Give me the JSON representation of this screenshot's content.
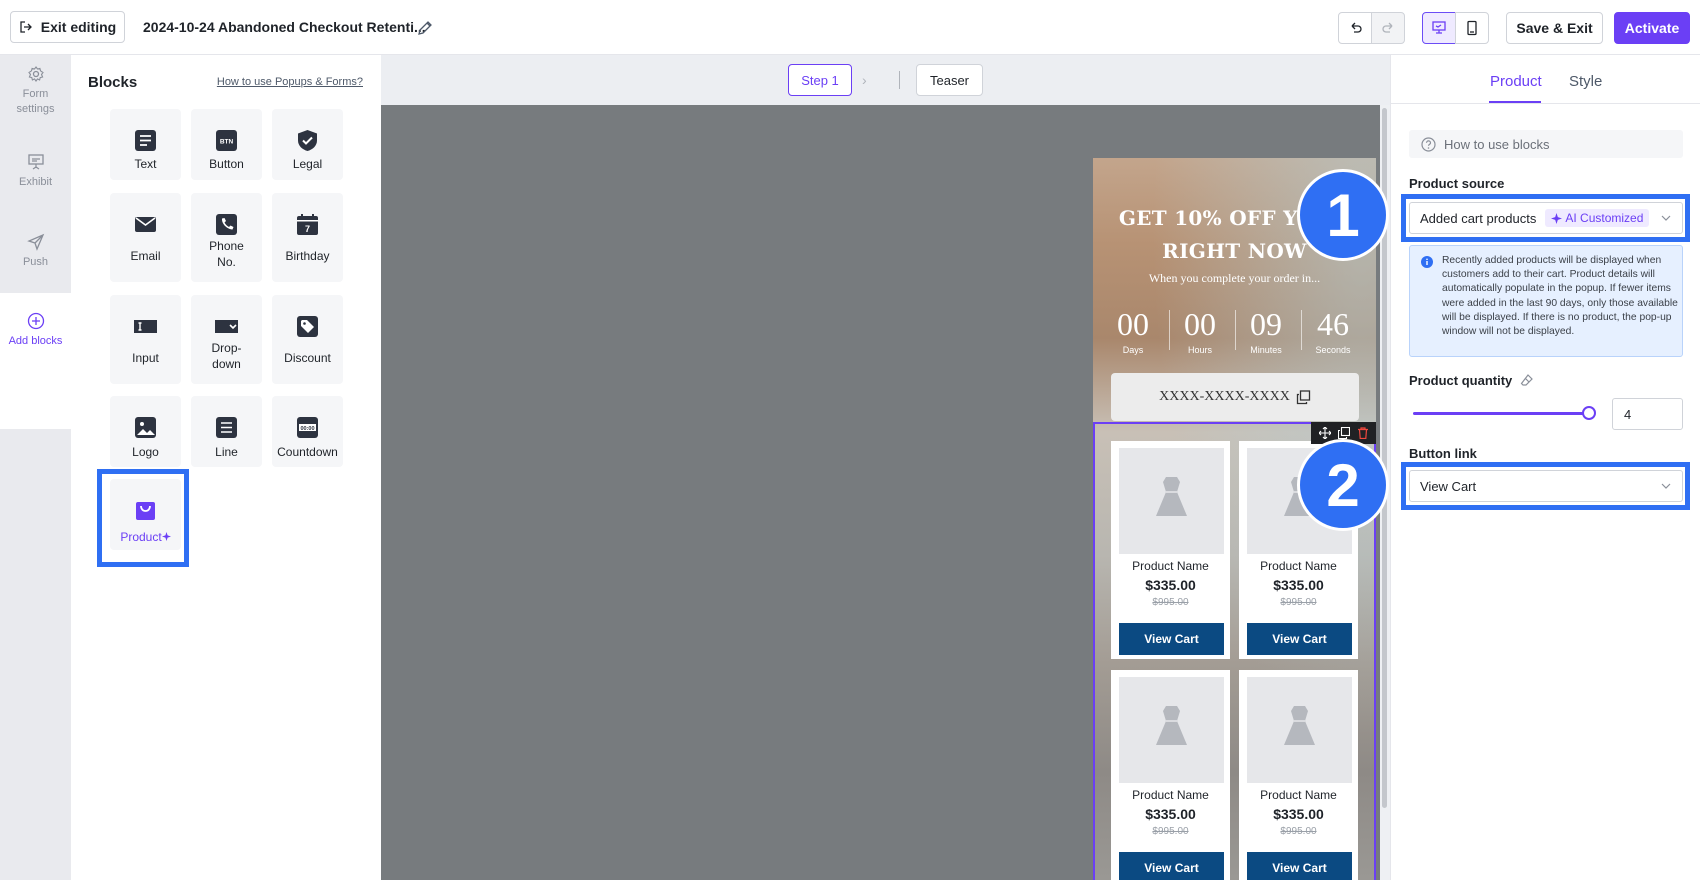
{
  "topbar": {
    "exit_label": "Exit editing",
    "doc_title": "2024-10-24 Abandoned Checkout Retenti...",
    "save_exit_label": "Save & Exit",
    "activate_label": "Activate"
  },
  "rail": {
    "items": [
      {
        "label_1": "Form",
        "label_2": "settings",
        "icon": "gear-icon"
      },
      {
        "label": "Exhibit",
        "icon": "presentation-icon"
      },
      {
        "label": "Push",
        "icon": "send-icon"
      },
      {
        "label": "Add blocks",
        "icon": "plus-circle-icon"
      }
    ]
  },
  "blocks": {
    "title": "Blocks",
    "help_link": "How to use Popups & Forms?",
    "tiles": [
      {
        "label": "Text",
        "icon": "text-icon"
      },
      {
        "label": "Button",
        "icon": "button-icon",
        "icon_text": "BTN"
      },
      {
        "label": "Legal",
        "icon": "shield-check-icon"
      },
      {
        "label": "Email",
        "icon": "envelope-icon"
      },
      {
        "label_1": "Phone",
        "label_2": "No.",
        "icon": "phone-icon"
      },
      {
        "label": "Birthday",
        "icon": "calendar-icon",
        "icon_text": "7"
      },
      {
        "label": "Input",
        "icon": "input-icon"
      },
      {
        "label_1": "Drop-",
        "label_2": "down",
        "icon": "dropdown-icon"
      },
      {
        "label": "Discount",
        "icon": "tag-icon"
      },
      {
        "label": "Logo",
        "icon": "image-icon"
      },
      {
        "label": "Line",
        "icon": "line-icon"
      },
      {
        "label": "Countdown",
        "icon": "countdown-icon",
        "icon_text": "00:00"
      },
      {
        "label": "Product",
        "icon": "shopping-bag-icon"
      }
    ]
  },
  "canvas": {
    "step_label": "Step 1",
    "teaser_label": "Teaser",
    "popup": {
      "title_line1": "GET 10% OFF YOUR",
      "title_line2": "RIGHT NOW",
      "subtitle": "When you complete your order in...",
      "countdown": [
        {
          "value": "00",
          "label": "Days"
        },
        {
          "value": "00",
          "label": "Hours"
        },
        {
          "value": "09",
          "label": "Minutes"
        },
        {
          "value": "46",
          "label": "Seconds"
        }
      ],
      "coupon_code": "XXXX-XXXX-XXXX",
      "products": [
        {
          "name": "Product Name",
          "price": "$335.00",
          "old_price": "$995.00",
          "button": "View Cart"
        },
        {
          "name": "Product Name",
          "price": "$335.00",
          "old_price": "$995.00",
          "button": "View Cart"
        },
        {
          "name": "Product Name",
          "price": "$335.00",
          "old_price": "$995.00",
          "button": "View Cart"
        },
        {
          "name": "Product Name",
          "price": "$335.00",
          "old_price": "$995.00",
          "button": "View Cart"
        }
      ]
    }
  },
  "right_panel": {
    "tabs": [
      "Product",
      "Style"
    ],
    "how_to": "How to use blocks",
    "product_source_label": "Product source",
    "product_source_value": "Added cart products",
    "ai_badge": "AI Customized",
    "info_text": "Recently added products will be displayed when customers add to their cart. Product details will automatically populate in the popup. If fewer items were added in the last 90 days, only those available will be displayed. If there is no product, the pop-up window will not be displayed.",
    "quantity_label": "Product quantity",
    "quantity_value": "4",
    "quantity_slider_level": 1.0,
    "button_link_label": "Button link",
    "button_link_value": "View Cart"
  },
  "annotations": {
    "marker_1": "1",
    "marker_2": "2"
  },
  "colors": {
    "accent": "#6b3ff5",
    "highlight": "#2f6ff3",
    "view_cart_button": "#0b4a82"
  }
}
